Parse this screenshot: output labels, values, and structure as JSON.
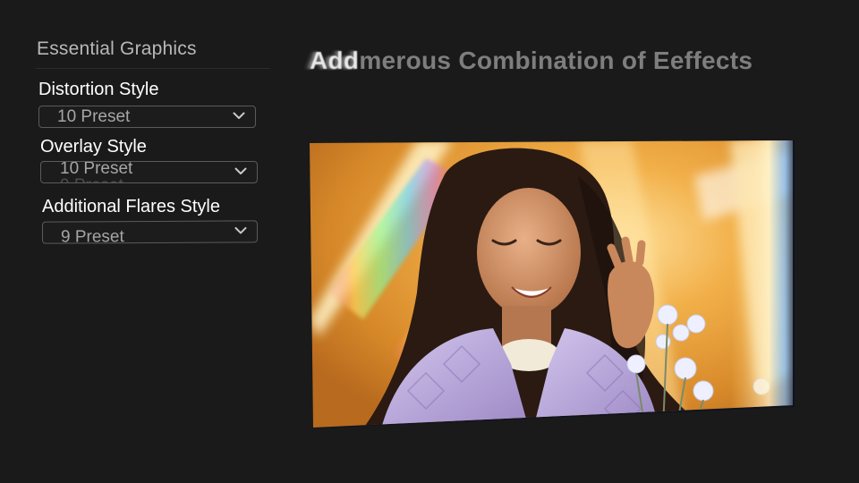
{
  "panel": {
    "title": "Essential Graphics",
    "groups": [
      {
        "label": "Distortion Style",
        "value": "10 Preset",
        "ghost": ""
      },
      {
        "label": "Overlay Style",
        "value": "10 Preset",
        "ghost": "9 Preset"
      },
      {
        "label": "Additional Flares Style",
        "value": "9 Preset",
        "ghost": ""
      }
    ]
  },
  "headline": {
    "animated_word": "Add",
    "rest": "merous Combination of Eeffects"
  },
  "preview": {
    "subject": "woman-with-flowers-photo",
    "colors": {
      "background_warm": "#e8a030",
      "glow": "#ffe08a",
      "jacket": "#b9a8d8",
      "hair": "#2a1a12",
      "skin": "#c98a5e",
      "flowers": "#eef0ff"
    }
  },
  "icons": {
    "dropdown": "chevron-down-icon"
  }
}
